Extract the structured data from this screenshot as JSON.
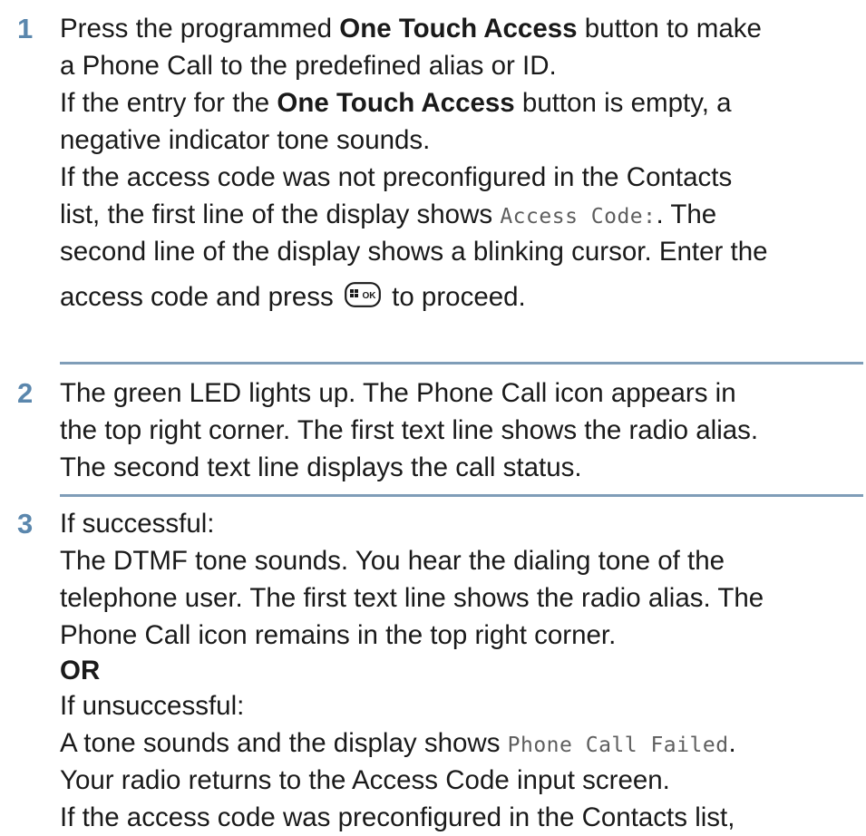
{
  "steps": [
    {
      "number": "1",
      "lines": {
        "l1_a": "Press the programmed ",
        "l1_b": "One Touch Access",
        "l1_c": " button to make",
        "l2": "a Phone Call to the predefined alias or ID.",
        "l3_a": "If the entry for the ",
        "l3_b": "One Touch Access",
        "l3_c": " button is empty, a",
        "l4": "negative indicator tone sounds.",
        "l5": "If the access code was not preconfigured in the Contacts",
        "l6_a": "list, the first line of the display shows ",
        "l6_lcd": "Access Code:",
        "l6_c": ". The",
        "l7": "second line of the display shows a blinking cursor. Enter the",
        "l8_a": "access code and press ",
        "l8_b": " to proceed."
      },
      "button_icon": "menu-ok-button-icon",
      "button_text": "OK"
    },
    {
      "number": "2",
      "lines": {
        "l1": "The green LED lights up. The Phone Call icon appears in",
        "l2": "the top right corner. The first text line shows the radio alias.",
        "l3": "The second text line displays the call status."
      }
    },
    {
      "number": "3",
      "lines": {
        "l1": "If successful:",
        "l2": "The DTMF tone sounds. You hear the dialing tone of the",
        "l3": "telephone user. The first text line shows the radio alias. The",
        "l4": "Phone Call icon remains in the top right corner.",
        "l5": "OR",
        "l6": "If unsuccessful:",
        "l7_a": "A tone sounds and the display shows ",
        "l7_lcd": "Phone Call Failed",
        "l7_c": ".",
        "l8": "Your radio returns to the Access Code input screen.",
        "l9": "If the access code was preconfigured in the Contacts list,"
      }
    }
  ],
  "colors": {
    "step_number": "#5b87ad",
    "rule": "#7f9db8",
    "text": "#1a1a1a",
    "display_text": "#5e5e5e"
  }
}
